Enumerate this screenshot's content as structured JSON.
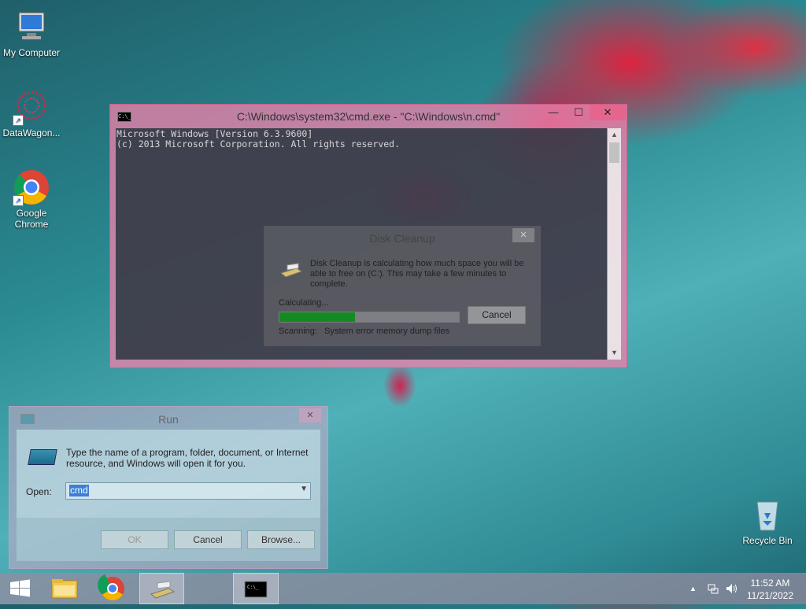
{
  "desktop": {
    "icons": [
      {
        "label": "My Computer",
        "icon": "computer-icon"
      },
      {
        "label": "DataWagon...",
        "icon": "datawagon-icon"
      },
      {
        "label": "Google Chrome",
        "icon": "chrome-icon"
      },
      {
        "label": "Recycle Bin",
        "icon": "recycle-bin-icon"
      }
    ]
  },
  "cmd_window": {
    "title": "C:\\Windows\\system32\\cmd.exe - \"C:\\Windows\\n.cmd\"",
    "lines": [
      "Microsoft Windows [Version 6.3.9600]",
      "(c) 2013 Microsoft Corporation. All rights reserved."
    ],
    "minimize": "—",
    "maximize": "☐",
    "close": "✕"
  },
  "disk_cleanup": {
    "title": "Disk Cleanup",
    "message": "Disk Cleanup is calculating how much space you will be able to free on  (C:). This may take a few minutes to complete.",
    "status": "Calculating...",
    "progress_fraction": 0.42,
    "cancel_label": "Cancel",
    "scanning_label": "Scanning:",
    "scanning_item": "System error memory dump files",
    "close": "✕"
  },
  "run_dialog": {
    "title": "Run",
    "description": "Type the name of a program, folder, document, or Internet resource, and Windows will open it for you.",
    "open_label": "Open:",
    "open_value": "cmd",
    "ok_label": "OK",
    "cancel_label": "Cancel",
    "browse_label": "Browse...",
    "close": "✕"
  },
  "taskbar": {
    "time": "11:52 AM",
    "date": "11/21/2022",
    "items": [
      "start-icon",
      "file-explorer-icon",
      "chrome-icon",
      "disk-cleanup-icon",
      "cmd-icon"
    ]
  }
}
